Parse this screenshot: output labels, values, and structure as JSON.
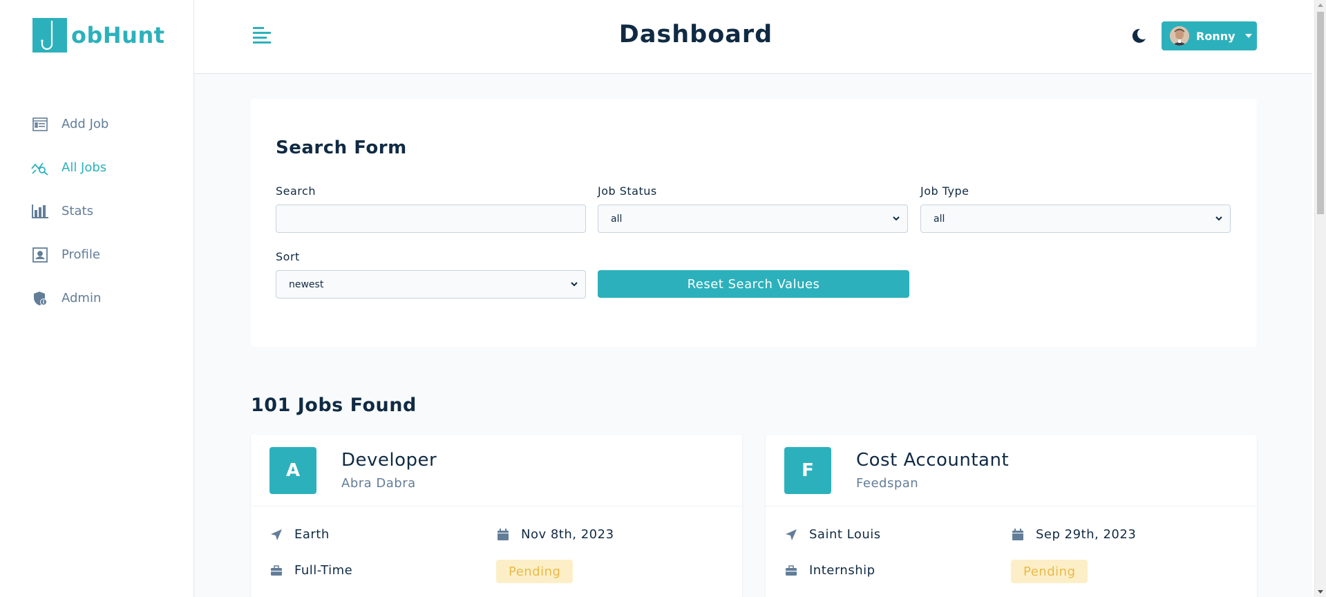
{
  "app": {
    "logo_text": "obHunt"
  },
  "sidebar": {
    "items": [
      {
        "label": "Add Job",
        "icon": "list-form-icon",
        "active": false
      },
      {
        "label": "All Jobs",
        "icon": "chart-search-icon",
        "active": true
      },
      {
        "label": "Stats",
        "icon": "bar-chart-icon",
        "active": false
      },
      {
        "label": "Profile",
        "icon": "profile-card-icon",
        "active": false
      },
      {
        "label": "Admin",
        "icon": "shield-icon",
        "active": false
      }
    ]
  },
  "header": {
    "title": "Dashboard",
    "user_name": "Ronny"
  },
  "search_form": {
    "title": "Search Form",
    "search_label": "Search",
    "search_value": "",
    "status_label": "Job Status",
    "status_value": "all",
    "type_label": "Job Type",
    "type_value": "all",
    "sort_label": "Sort",
    "sort_value": "newest",
    "reset_label": "Reset Search Values"
  },
  "results": {
    "count_text": "101 Jobs Found"
  },
  "jobs": [
    {
      "letter": "A",
      "position": "Developer",
      "company": "Abra Dabra",
      "location": "Earth",
      "date": "Nov 8th, 2023",
      "job_type": "Full-Time",
      "status": "Pending"
    },
    {
      "letter": "F",
      "position": "Cost Accountant",
      "company": "Feedspan",
      "location": "Saint Louis",
      "date": "Sep 29th, 2023",
      "job_type": "Internship",
      "status": "Pending"
    }
  ],
  "colors": {
    "primary": "#2cb1bc",
    "text_dark": "#102a43",
    "text_muted": "#627d98",
    "pending_bg": "#fcefc7",
    "pending_text": "#e9b949"
  }
}
